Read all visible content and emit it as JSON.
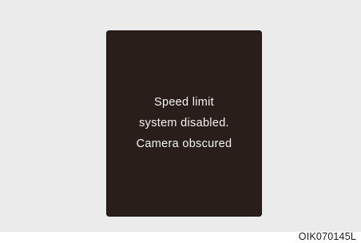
{
  "display": {
    "message_lines": [
      "Speed limit",
      "system disabled.",
      "Camera obscured"
    ]
  },
  "figure": {
    "code": "OIK070145L"
  },
  "colors": {
    "background_panel": "#ebebeb",
    "display_background": "#2a1e1a",
    "display_text": "#f3f3f3"
  }
}
